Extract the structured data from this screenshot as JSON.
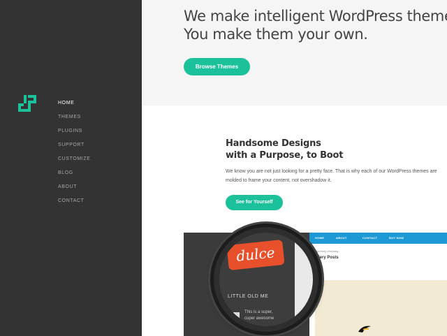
{
  "sidebar": {
    "logo_icon": "stylized-s-logo-icon",
    "accent": "#1bc19a",
    "nav": [
      "HOME",
      "THEMES",
      "PLUGINS",
      "SUPPORT",
      "CUSTOMIZE",
      "BLOG",
      "ABOUT",
      "CONTACT"
    ],
    "active": "HOME"
  },
  "hero": {
    "line1": "We make intelligent WordPress themes.",
    "line2": "You make them your own.",
    "button": "Browse Themes"
  },
  "section": {
    "title_line1": "Handsome Designs",
    "title_line2": "with a Purpose, to Boot",
    "body_line1": "We know you are not just looking for a pretty face. That is why each of our WordPress themes are",
    "body_line2": "molded to frame your content, not overshadow it.",
    "button": "See for Yourself"
  },
  "preview": {
    "nav": [
      "HOME",
      "ABOUT",
      "CONTACT",
      "BUY NOW"
    ],
    "small_label": "Currently browsing",
    "heading": "allery Posts",
    "brand": "dulce",
    "lens_heading": "LITTLE OLD ME",
    "lens_text_line1": "This is a super,",
    "lens_text_line2": "cuper awesome"
  }
}
